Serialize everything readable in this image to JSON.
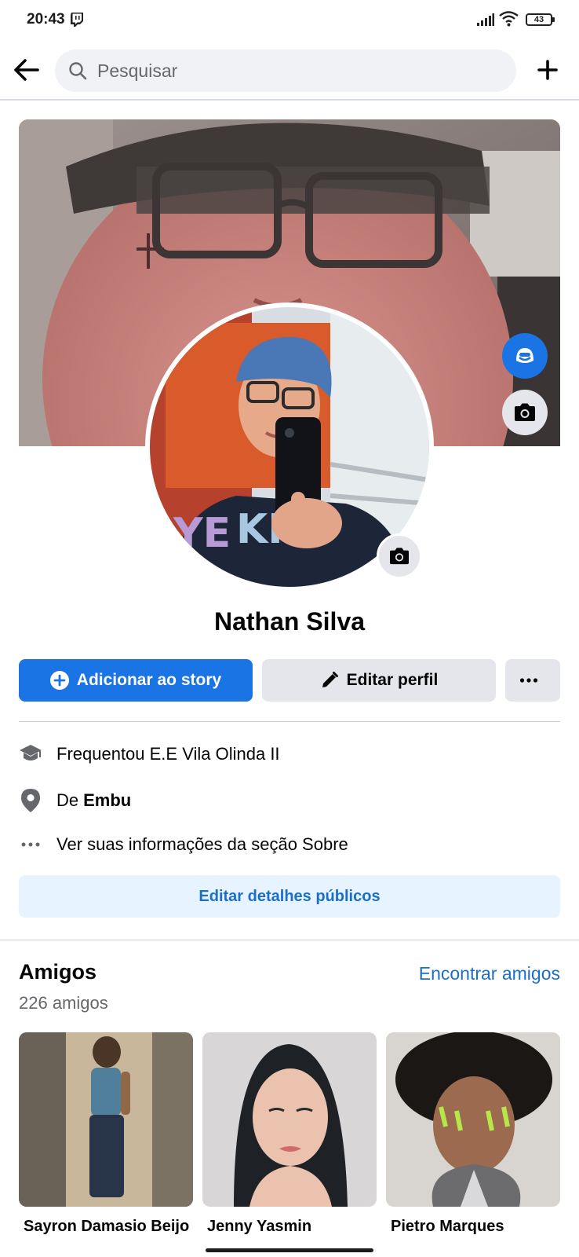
{
  "status_bar": {
    "time": "20:43",
    "battery": "43",
    "icons": [
      "twitch-icon",
      "signal-icon",
      "wifi-icon",
      "battery-icon"
    ]
  },
  "top_bar": {
    "back_icon": "arrow-left-icon",
    "search_placeholder": "Pesquisar",
    "add_icon": "plus-icon"
  },
  "profile": {
    "name": "Nathan Silva",
    "cover_buttons": [
      "avatar-icon",
      "camera-icon"
    ],
    "profile_camera_icon": "camera-icon"
  },
  "actions": {
    "story_label": "Adicionar ao story",
    "edit_label": "Editar perfil",
    "more_icon": "more-horizontal-icon"
  },
  "details": {
    "education": "Frequentou E.E Vila Olinda II",
    "hometown_prefix": "De",
    "hometown": "Embu",
    "about": "Ver suas informações da seção Sobre",
    "edit_button": "Editar detalhes públicos"
  },
  "friends": {
    "title": "Amigos",
    "count": "226 amigos",
    "find_link": "Encontrar amigos",
    "list": [
      {
        "name": "Sayron Damasio Beijo"
      },
      {
        "name": "Jenny Yasmin"
      },
      {
        "name": "Pietro Marques"
      }
    ]
  },
  "colors": {
    "primary": "#1b74e4",
    "link": "#1b6fc6",
    "secondary_button": "#e4e6eb",
    "light_blue_button": "#e7f3ff",
    "muted_text": "#65676b"
  }
}
